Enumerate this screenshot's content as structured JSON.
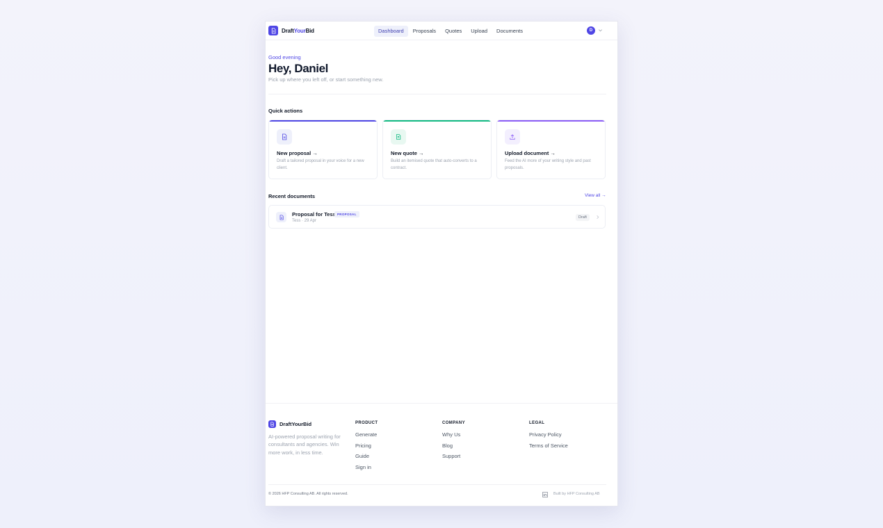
{
  "header": {
    "logo_part1": "Draft",
    "logo_part2": "Your",
    "logo_part3": "Bid",
    "nav": [
      {
        "label": "Dashboard",
        "active": true
      },
      {
        "label": "Proposals"
      },
      {
        "label": "Quotes"
      },
      {
        "label": "Upload"
      },
      {
        "label": "Documents"
      }
    ],
    "avatar_initial": "D"
  },
  "greeting": {
    "small": "Good evening",
    "title": "Hey, Daniel",
    "subtitle": "Pick up where you left off, or start something new."
  },
  "quick_actions": {
    "title": "Quick actions",
    "cards": [
      {
        "title": "New proposal →",
        "desc": "Draft a tailored proposal in your voice for a new client.",
        "accent": "#4f46e5",
        "icon": "document-icon"
      },
      {
        "title": "New quote →",
        "desc": "Build an itemised quote that auto-converts to a contract.",
        "accent": "#10b981",
        "icon": "quote-icon"
      },
      {
        "title": "Upload document →",
        "desc": "Feed the AI more of your writing style and past proposals.",
        "accent": "#8b5cf6",
        "icon": "upload-icon"
      }
    ]
  },
  "recent": {
    "title": "Recent documents",
    "view_all": "View all →",
    "items": [
      {
        "title": "Proposal for Tess",
        "tag": "PROPOSAL",
        "meta": "Tess · 29 Apr",
        "status": "Draft"
      }
    ]
  },
  "footer": {
    "brand": "DraftYourBid",
    "description": "AI-powered proposal writing for consultants and agencies. Win more work, in less time.",
    "columns": [
      {
        "heading": "PRODUCT",
        "links": [
          "Generate",
          "Pricing",
          "Guide",
          "Sign in"
        ]
      },
      {
        "heading": "COMPANY",
        "links": [
          "Why Us",
          "Blog",
          "Support"
        ]
      },
      {
        "heading": "LEGAL",
        "links": [
          "Privacy Policy",
          "Terms of Service"
        ]
      }
    ],
    "copyright": "© 2026 HFP Consulting AB. All rights reserved.",
    "built_by": "Built by HFP Consulting AB"
  }
}
